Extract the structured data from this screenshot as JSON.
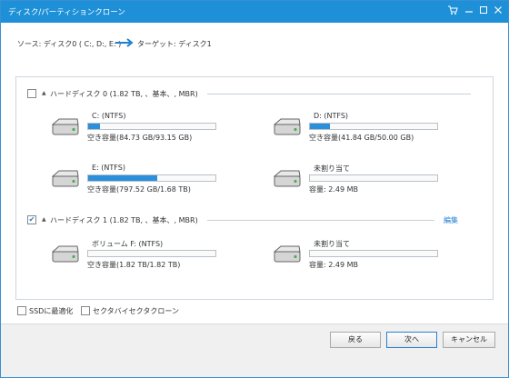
{
  "window": {
    "title": "ディスク/パーティションクローン"
  },
  "summary": {
    "source": "ソース:  ディスク0 ( C:, D:, E: )",
    "target": "ターゲット:  ディスク1"
  },
  "disks": [
    {
      "label": "ハードディスク 0 (1.82 TB, 、基本、, MBR)",
      "checked": false,
      "partitions": [
        {
          "name": "C: (NTFS)",
          "capacity": "空き容量(84.73 GB/93.15 GB)",
          "fill_fraction": 0.09
        },
        {
          "name": "D: (NTFS)",
          "capacity": "空き容量(41.84 GB/50.00 GB)",
          "fill_fraction": 0.16
        },
        {
          "name": "E: (NTFS)",
          "capacity": "空き容量(797.52 GB/1.68 TB)",
          "fill_fraction": 0.54
        },
        {
          "name": "未割り当て",
          "capacity": "容量: 2.49 MB",
          "fill_fraction": 0
        }
      ]
    },
    {
      "label": "ハードディスク 1 (1.82 TB, 、基本、, MBR)",
      "checked": true,
      "edit_label": "編集",
      "partitions": [
        {
          "name": "ボリューム F: (NTFS)",
          "capacity": "空き容量(1.82 TB/1.82 TB)",
          "fill_fraction": 0
        },
        {
          "name": "未割り当て",
          "capacity": "容量: 2.49 MB",
          "fill_fraction": 0
        }
      ]
    }
  ],
  "options": {
    "ssd": "SSDに最適化",
    "sector": "セクタバイセクタクローン"
  },
  "buttons": {
    "back": "戻る",
    "next": "次へ",
    "cancel": "キャンセル"
  },
  "colors": {
    "accent": "#1e90d8",
    "bar_fill": "#2b8fdc"
  }
}
